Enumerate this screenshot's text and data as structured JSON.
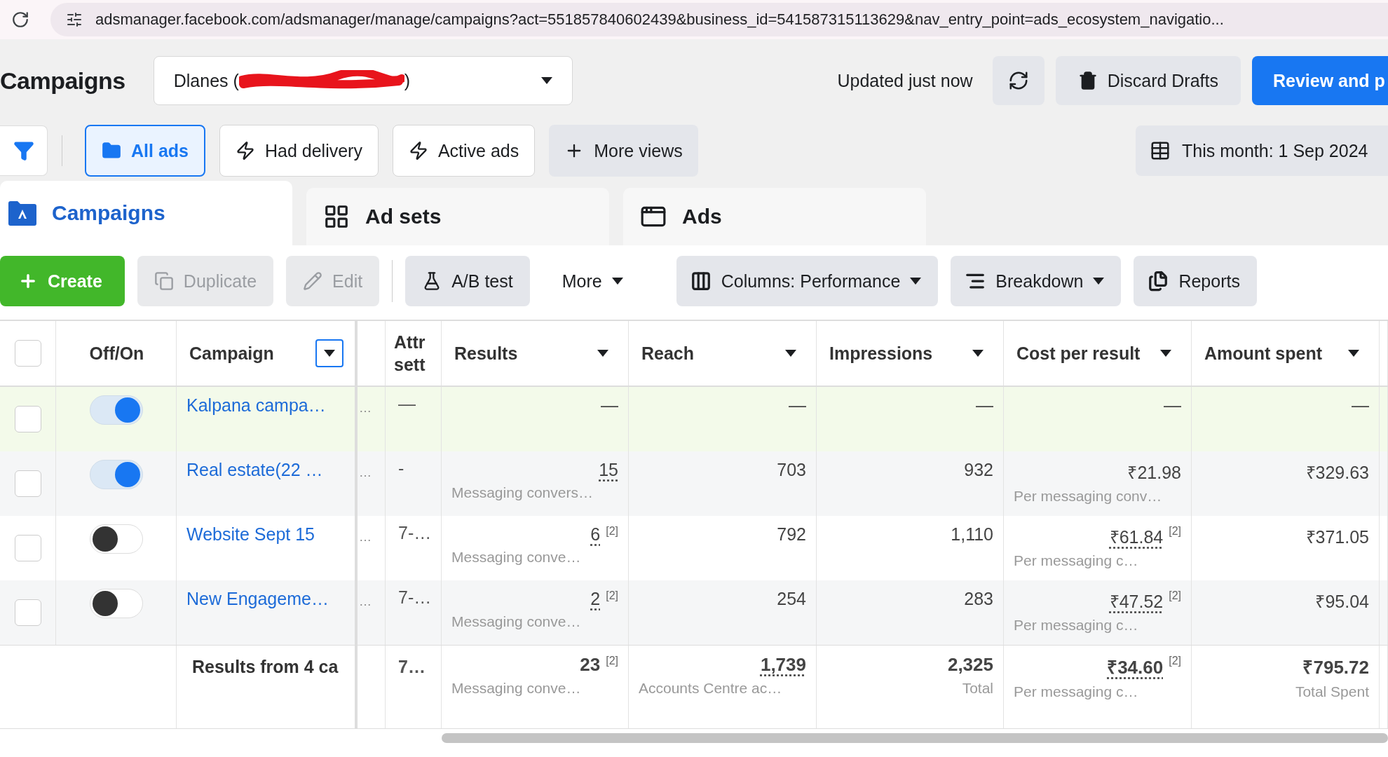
{
  "browser": {
    "url": "adsmanager.facebook.com/adsmanager/manage/campaigns?act=551857840602439&business_id=541587315113629&nav_entry_point=ads_ecosystem_navigatio..."
  },
  "header": {
    "title": "Campaigns",
    "account": {
      "prefix": "Dlanes (",
      "suffix": ")",
      "redacted": true
    },
    "status": "Updated just now",
    "discard": "Discard Drafts",
    "review": "Review and p"
  },
  "views": [
    {
      "label": "All ads",
      "kind": "view",
      "selected": true
    },
    {
      "label": "Had delivery",
      "kind": "view",
      "selected": false
    },
    {
      "label": "Active ads",
      "kind": "view",
      "selected": false
    },
    {
      "label": "More views",
      "kind": "add",
      "selected": false
    }
  ],
  "date_range": "This month: 1 Sep 2024",
  "level_tabs": [
    {
      "label": "Campaigns",
      "selected": true
    },
    {
      "label": "Ad sets",
      "selected": false
    },
    {
      "label": "Ads",
      "selected": false
    }
  ],
  "actions": [
    {
      "label": "Create",
      "kind": "primary",
      "disabled": false
    },
    {
      "label": "Duplicate",
      "kind": "secondary",
      "disabled": true
    },
    {
      "label": "Edit",
      "kind": "secondary",
      "disabled": true
    },
    {
      "label": "A/B test",
      "kind": "secondary",
      "disabled": false
    },
    {
      "label": "More",
      "kind": "menu",
      "disabled": false
    }
  ],
  "tools": [
    {
      "label": "Columns: Performance",
      "dropdown": true
    },
    {
      "label": "Breakdown",
      "dropdown": true
    },
    {
      "label": "Reports",
      "dropdown": false
    }
  ],
  "table": {
    "select_all": {
      "checked": false
    },
    "toggle_header": "Off/On",
    "columns": [
      {
        "label": "Campaign",
        "has_menu": true,
        "focused": true
      },
      {
        "has_menu": false
      },
      {
        "label": "Attr\nsett",
        "has_menu": false
      },
      {
        "label": "Results",
        "has_menu": true
      },
      {
        "label": "Reach",
        "has_menu": true
      },
      {
        "label": "Impressions",
        "has_menu": true
      },
      {
        "label": "Cost per result",
        "has_menu": true
      },
      {
        "label": "Amount spent",
        "has_menu": true
      }
    ],
    "rows": [
      {
        "checked": false,
        "on": true,
        "highlighted": true,
        "cells": [
          "Kalpana campa…",
          "…",
          "—",
          {
            "value": "—",
            "underlined": false
          },
          {
            "value": "—",
            "underlined": false
          },
          {
            "value": "—",
            "underlined": false
          },
          {
            "value": "—",
            "underlined": false
          },
          {
            "value": "—",
            "underlined": false
          }
        ]
      },
      {
        "checked": false,
        "on": true,
        "highlighted": false,
        "cells": [
          "Real estate(22 …",
          "…",
          "-",
          {
            "value": "15",
            "sub": "Messaging convers…",
            "underlined": true
          },
          {
            "value": "703",
            "underlined": false
          },
          {
            "value": "932",
            "underlined": false
          },
          {
            "value": "₹21.98",
            "sub": "Per messaging conv…",
            "underlined": false
          },
          {
            "value": "₹329.63",
            "underlined": false
          }
        ]
      },
      {
        "checked": false,
        "on": false,
        "highlighted": false,
        "cells": [
          "Website Sept 15",
          "…",
          "7-…",
          {
            "value": "6",
            "note": "[2]",
            "sub": "Messaging conve…",
            "underlined": true
          },
          {
            "value": "792",
            "underlined": false
          },
          {
            "value": "1,110",
            "underlined": false
          },
          {
            "value": "₹61.84",
            "note": "[2]",
            "sub": "Per messaging c…",
            "underlined": true
          },
          {
            "value": "₹371.05",
            "underlined": false
          }
        ]
      },
      {
        "checked": false,
        "on": false,
        "highlighted": false,
        "cells": [
          "New Engageme…",
          "…",
          "7-…",
          {
            "value": "2",
            "note": "[2]",
            "sub": "Messaging conve…",
            "underlined": true
          },
          {
            "value": "254",
            "underlined": false
          },
          {
            "value": "283",
            "underlined": false
          },
          {
            "value": "₹47.52",
            "note": "[2]",
            "sub": "Per messaging c…",
            "underlined": true
          },
          {
            "value": "₹95.04",
            "underlined": false
          }
        ]
      }
    ],
    "total": {
      "cells": [
        "Results from 4 ca",
        "",
        "7…",
        {
          "value": "23",
          "note": "[2]",
          "sub": "Messaging conve…",
          "underlined": false
        },
        {
          "value": "1,739",
          "sub": "Accounts Centre ac…",
          "underlined": true
        },
        {
          "value": "2,325",
          "sub": "Total",
          "underlined": false
        },
        {
          "value": "₹34.60",
          "note": "[2]",
          "sub": "Per messaging c…",
          "underlined": true
        },
        {
          "value": "₹795.72",
          "sub": "Total Spent",
          "underlined": false
        }
      ]
    }
  }
}
